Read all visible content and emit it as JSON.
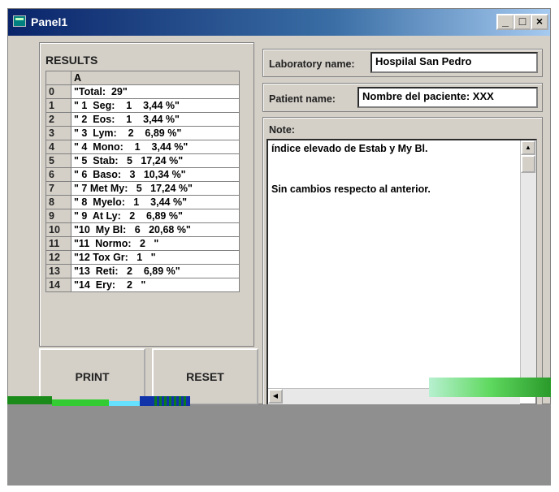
{
  "window": {
    "title": "Panel1"
  },
  "titlebar_buttons": {
    "minimize": "_",
    "maximize": "□",
    "close": "×"
  },
  "results": {
    "heading": "RESULTS",
    "column_header": "A",
    "rows": [
      {
        "n": "0",
        "v": "\"Total:  29\""
      },
      {
        "n": "1",
        "v": "\" 1  Seg:    1    3,44 %\""
      },
      {
        "n": "2",
        "v": "\" 2  Eos:    1    3,44 %\""
      },
      {
        "n": "3",
        "v": "\" 3  Lym:    2    6,89 %\""
      },
      {
        "n": "4",
        "v": "\" 4  Mono:    1    3,44 %\""
      },
      {
        "n": "5",
        "v": "\" 5  Stab:   5   17,24 %\""
      },
      {
        "n": "6",
        "v": "\" 6  Baso:   3   10,34 %\""
      },
      {
        "n": "7",
        "v": "\" 7 Met My:   5   17,24 %\""
      },
      {
        "n": "8",
        "v": "\" 8  Myelo:   1    3,44 %\""
      },
      {
        "n": "9",
        "v": "\" 9  At Ly:   2    6,89 %\""
      },
      {
        "n": "10",
        "v": "\"10  My Bl:   6   20,68 %\""
      },
      {
        "n": "11",
        "v": "\"11  Normo:   2   \""
      },
      {
        "n": "12",
        "v": "\"12 Tox Gr:   1   \""
      },
      {
        "n": "13",
        "v": "\"13  Reti:   2    6,89 %\""
      },
      {
        "n": "14",
        "v": "\"14  Ery:    2   \""
      }
    ]
  },
  "buttons": {
    "print": "PRINT",
    "reset": "RESET"
  },
  "lab": {
    "label": "Laboratory name:",
    "value": "Hospilal San Pedro"
  },
  "patient": {
    "label": "Patient name:",
    "value": "Nombre del paciente: XXX"
  },
  "note": {
    "label": "Note:",
    "lines": [
      "índice elevado de Estab y My Bl.",
      "Sin cambios respecto al anterior."
    ]
  },
  "colors": {
    "title_start": "#0a246a",
    "title_end": "#a6caf0",
    "face": "#d4d0c8",
    "bottom": "#8f8f8f"
  }
}
